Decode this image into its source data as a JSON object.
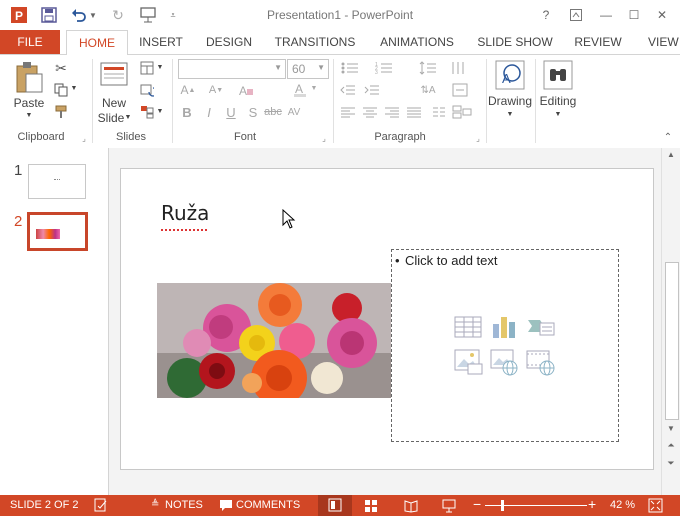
{
  "window": {
    "title": "Presentation1 - PowerPoint"
  },
  "quick_access": {
    "icons": [
      "powerpoint-logo-icon",
      "save-icon",
      "undo-icon",
      "redo-icon",
      "present-icon",
      "customize-icon"
    ]
  },
  "window_controls": {
    "help": "?",
    "restore_ribbon": "⇪",
    "minimize": "—",
    "maximize": "☐",
    "close": "✕"
  },
  "tabs": [
    {
      "label": "FILE"
    },
    {
      "label": "HOME"
    },
    {
      "label": "INSERT"
    },
    {
      "label": "DESIGN"
    },
    {
      "label": "TRANSITIONS"
    },
    {
      "label": "ANIMATIONS"
    },
    {
      "label": "SLIDE SHOW"
    },
    {
      "label": "REVIEW"
    },
    {
      "label": "VIEW"
    }
  ],
  "ribbon": {
    "clipboard": {
      "label": "Clipboard",
      "paste": "Paste"
    },
    "slides": {
      "label": "Slides",
      "new_slide_1": "New",
      "new_slide_2": "Slide"
    },
    "font": {
      "label": "Font",
      "font_name": "",
      "font_size": "60"
    },
    "paragraph": {
      "label": "Paragraph"
    },
    "drawing": {
      "label": "Drawing"
    },
    "editing": {
      "label": "Editing"
    }
  },
  "thumbnails": [
    {
      "number": "1",
      "selected": false
    },
    {
      "number": "2",
      "selected": true
    }
  ],
  "slide": {
    "title": "Ruža",
    "placeholder": "Click to add text",
    "bullet": "•"
  },
  "status": {
    "slide_info": "SLIDE 2 OF 2",
    "notes": "NOTES",
    "comments": "COMMENTS",
    "zoom": "42 %"
  },
  "colors": {
    "accent": "#d24726",
    "tab_active": "#d24726"
  }
}
